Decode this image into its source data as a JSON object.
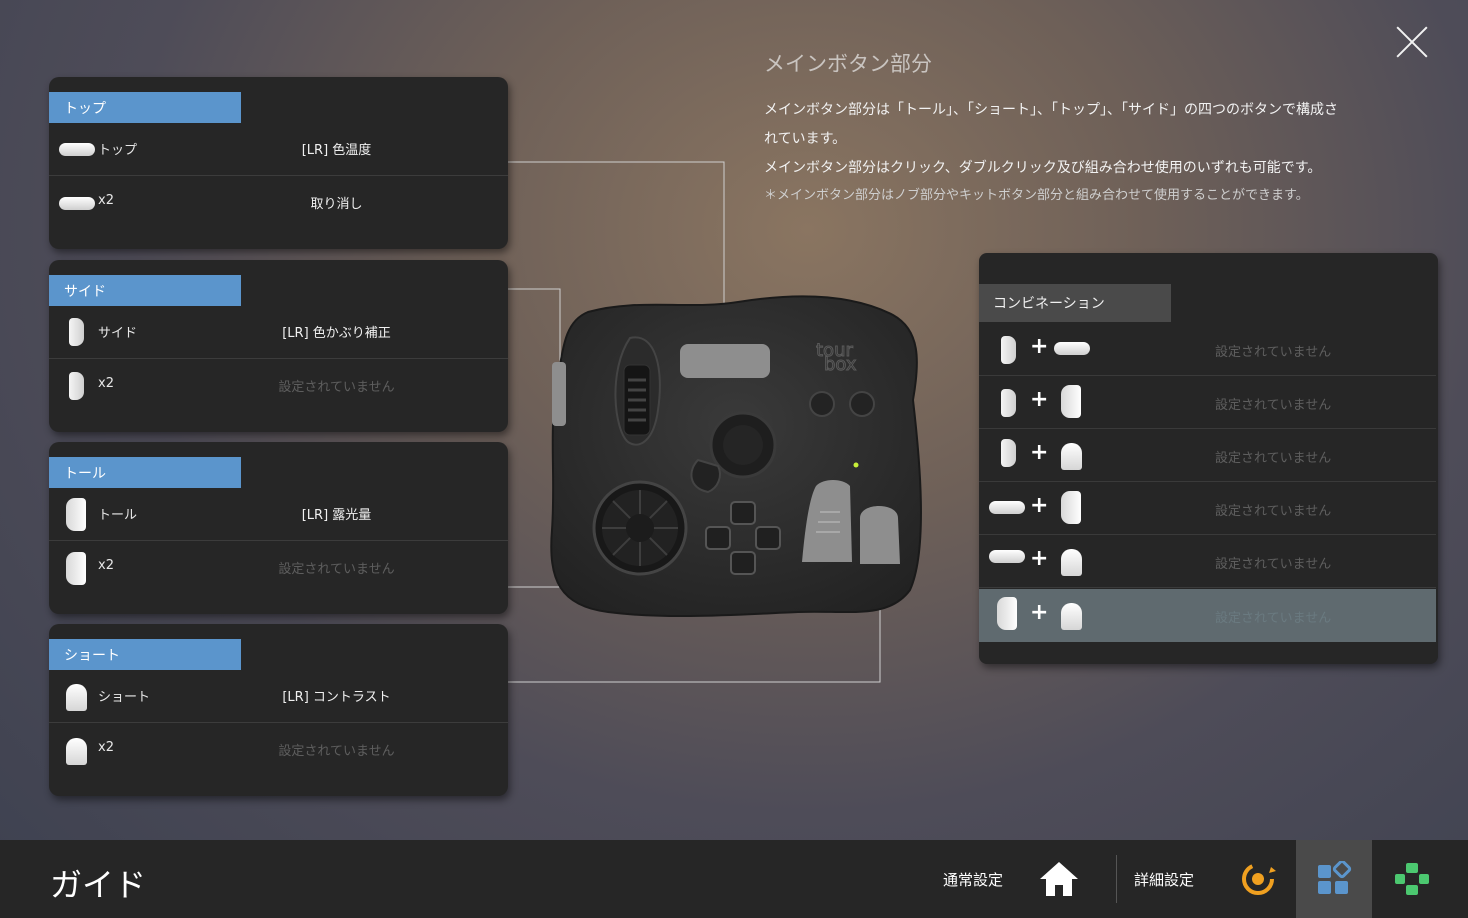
{
  "window": {
    "close_label": "×"
  },
  "info": {
    "title": "メインボタン部分",
    "line1": "メインボタン部分は「トール」、「ショート」、「トップ」、「サイド」の四つのボタンで構成さ",
    "line2": "れています。",
    "line3": "メインボタン部分はクリック、ダブルクリック及び組み合わせ使用のいずれも可能です。",
    "note": "＊メインボタン部分はノブ部分やキットボタン部分と組み合わせて使用することができます。"
  },
  "panels": [
    {
      "tab": "トップ",
      "icon": "top-button-icon",
      "rows": [
        {
          "label": "トップ",
          "value": "[LR] 色温度",
          "unset": false
        },
        {
          "label": "x2",
          "value": "取り消し",
          "unset": false
        }
      ]
    },
    {
      "tab": "サイド",
      "icon": "side-button-icon",
      "rows": [
        {
          "label": "サイド",
          "value": "[LR] 色かぶり補正",
          "unset": false
        },
        {
          "label": "x2",
          "value": "設定されていません",
          "unset": true
        }
      ]
    },
    {
      "tab": "トール",
      "icon": "tall-button-icon",
      "rows": [
        {
          "label": "トール",
          "value": "[LR] 露光量",
          "unset": false
        },
        {
          "label": "x2",
          "value": "設定されていません",
          "unset": true
        }
      ]
    },
    {
      "tab": "ショート",
      "icon": "short-button-icon",
      "rows": [
        {
          "label": "ショート",
          "value": "[LR] コントラスト",
          "unset": false
        },
        {
          "label": "x2",
          "value": "設定されていません",
          "unset": true
        }
      ]
    }
  ],
  "combination": {
    "tab": "コンビネーション",
    "plus": "+",
    "rows": [
      {
        "a": "side",
        "b": "top",
        "value": "設定されていません"
      },
      {
        "a": "side",
        "b": "tall",
        "value": "設定されていません"
      },
      {
        "a": "side",
        "b": "short",
        "value": "設定されていません"
      },
      {
        "a": "top",
        "b": "tall",
        "value": "設定されていません"
      },
      {
        "a": "top",
        "b": "short",
        "value": "設定されていません"
      },
      {
        "a": "tall",
        "b": "short",
        "value": "設定されていません",
        "selected": true
      }
    ]
  },
  "device": {
    "logo_line1": "tour",
    "logo_line2": "box"
  },
  "bottom_bar": {
    "title": "ガイド",
    "normal_settings": "通常設定",
    "advanced_settings": "詳細設定",
    "icons": [
      "home-icon",
      "rotate-settings-icon",
      "guide-grid-icon",
      "gamepad-icon"
    ],
    "accent_blue": "#5b95cc",
    "accent_orange": "#f0a020",
    "accent_green": "#4cc870"
  }
}
